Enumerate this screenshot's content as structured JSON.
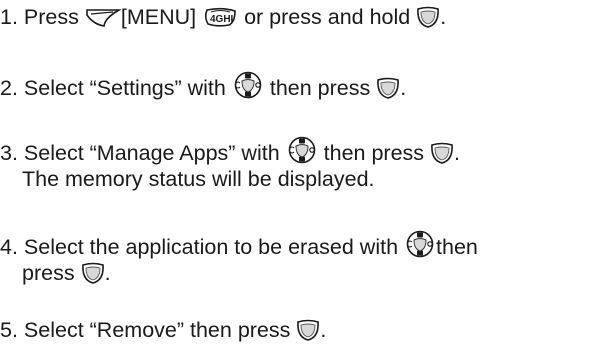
{
  "steps": [
    {
      "number": "1.",
      "part1": "Press",
      "key_menu": "[MENU]",
      "part2": "or press and hold",
      "end": "."
    },
    {
      "number": "2.",
      "part1": "Select “Settings” with",
      "part2": "then press",
      "end": "."
    },
    {
      "number": "3.",
      "part1": "Select “Manage Apps” with",
      "part2": "then press",
      "end": ".",
      "line2": "The memory status will be displayed."
    },
    {
      "number": "4.",
      "part1": "Select the application to be erased with",
      "part2": "then",
      "line2_part1": "press",
      "end": "."
    },
    {
      "number": "5.",
      "part1": "Select “Remove” then press",
      "end": "."
    }
  ],
  "keypad": {
    "four_label": "4GHI"
  },
  "icons": {
    "menu_soft_key": "left-soft-key-icon",
    "four_key": "four-ghi-key-icon",
    "ok_key": "ok-center-key-icon",
    "nav_key": "navigation-key-icon"
  }
}
